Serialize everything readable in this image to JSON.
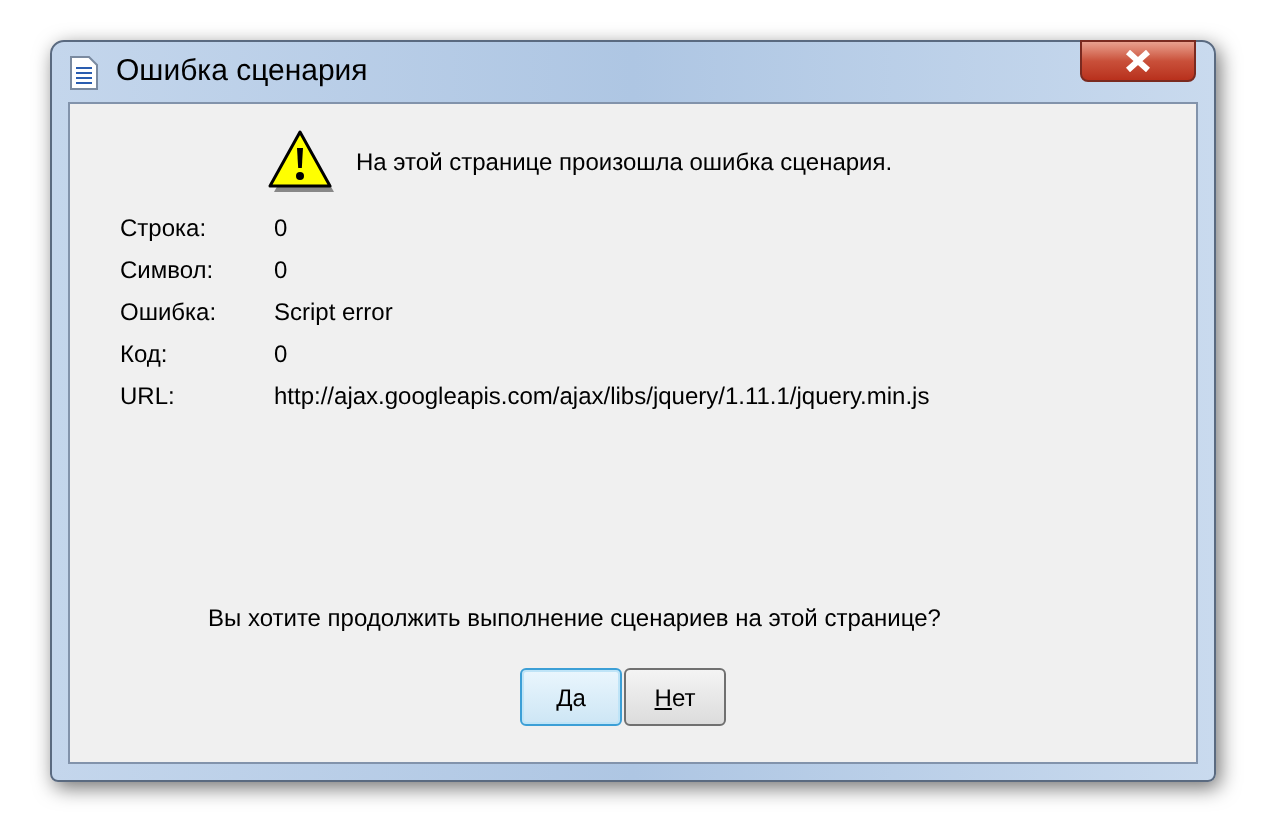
{
  "window": {
    "title": "Ошибка сценария"
  },
  "message": "На этой странице произошла ошибка сценария.",
  "details": [
    {
      "label": "Строка:",
      "value": "0"
    },
    {
      "label": "Символ:",
      "value": "0"
    },
    {
      "label": "Ошибка:",
      "value": "Script error"
    },
    {
      "label": "Код:",
      "value": "0"
    },
    {
      "label": "URL:",
      "value": "http://ajax.googleapis.com/ajax/libs/jquery/1.11.1/jquery.min.js"
    }
  ],
  "question": "Вы хотите продолжить выполнение сценариев на этой странице?",
  "buttons": [
    {
      "mnemonic": "Д",
      "rest": "а",
      "default": true
    },
    {
      "mnemonic": "Н",
      "rest": "ет",
      "default": false
    }
  ]
}
